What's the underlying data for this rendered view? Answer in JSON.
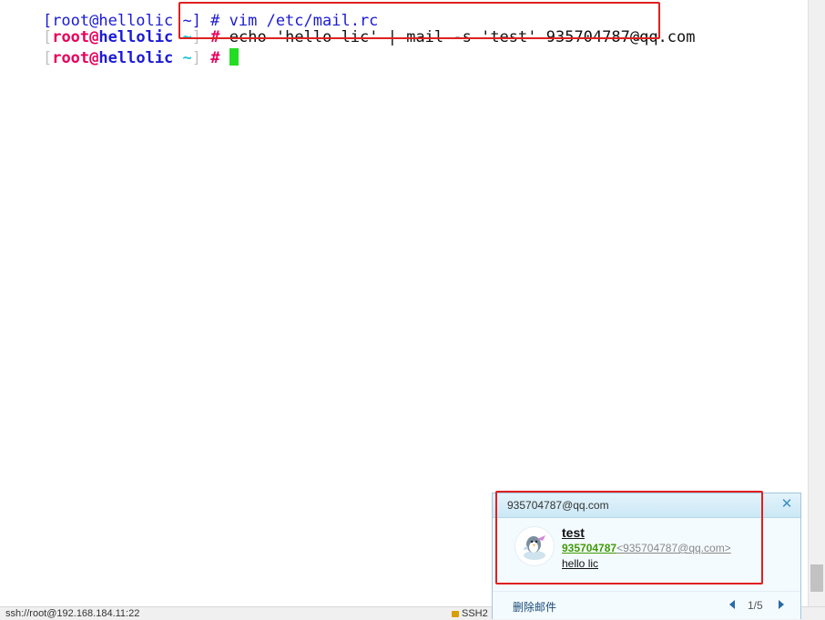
{
  "terminal": {
    "partial_line": "[root@hellolic ~] # vim /etc/mail.rc",
    "prompt": {
      "open": "[",
      "user": "root",
      "at": "@",
      "host": "hellolic",
      "tilde": " ~",
      "close": "]",
      "hash": " # "
    },
    "command": "echo 'hello lic' | mail -s 'test' 935704787@qq.com"
  },
  "status_bar": {
    "connection": "ssh://root@192.168.184.11:22",
    "protocol": "SSH2"
  },
  "notification": {
    "from_account": "935704787@qq.com",
    "close_glyph": "✕",
    "subject": "test",
    "sender_name": "935704787",
    "sender_address": "<935704787@qq.com>",
    "preview": "hello lic",
    "delete_label": "删除邮件",
    "pager": "1/5"
  },
  "colors": {
    "highlight_box": "#e02020",
    "cursor": "#22dd22",
    "prompt_user": "#e8005a",
    "prompt_host": "#1b1bd6",
    "prompt_tilde": "#1ec6d6"
  }
}
